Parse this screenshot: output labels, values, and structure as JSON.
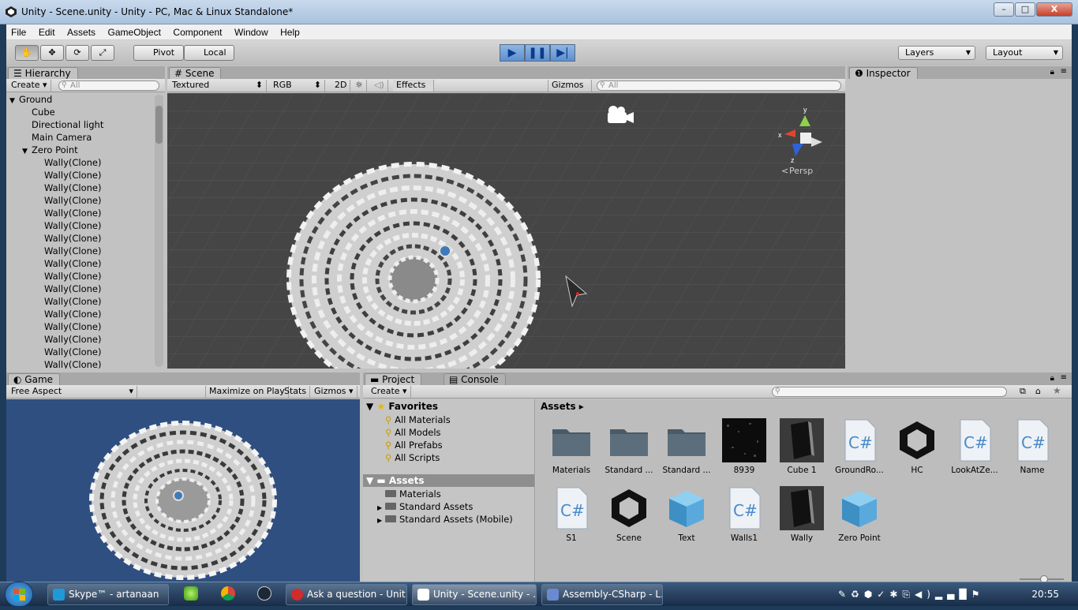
{
  "window": {
    "title": "Unity - Scene.unity - Unity - PC, Mac & Linux Standalone*",
    "min": "–",
    "max": "□",
    "close": "X"
  },
  "menu": [
    "File",
    "Edit",
    "Assets",
    "GameObject",
    "Component",
    "Window",
    "Help"
  ],
  "toolbar": {
    "pivot": "Pivot",
    "local": "Local",
    "layers": "Layers",
    "layout": "Layout"
  },
  "hierarchy": {
    "tab": "Hierarchy",
    "create": "Create",
    "search_placeholder": "All",
    "items": [
      {
        "label": "Ground",
        "indent": 0,
        "arrow": "▼"
      },
      {
        "label": "Cube",
        "indent": 1,
        "arrow": ""
      },
      {
        "label": "Directional light",
        "indent": 1,
        "arrow": ""
      },
      {
        "label": "Main Camera",
        "indent": 1,
        "arrow": ""
      },
      {
        "label": "Zero Point",
        "indent": 1,
        "arrow": "▼"
      },
      {
        "label": "Wally(Clone)",
        "indent": 2,
        "arrow": ""
      },
      {
        "label": "Wally(Clone)",
        "indent": 2,
        "arrow": ""
      },
      {
        "label": "Wally(Clone)",
        "indent": 2,
        "arrow": ""
      },
      {
        "label": "Wally(Clone)",
        "indent": 2,
        "arrow": ""
      },
      {
        "label": "Wally(Clone)",
        "indent": 2,
        "arrow": ""
      },
      {
        "label": "Wally(Clone)",
        "indent": 2,
        "arrow": ""
      },
      {
        "label": "Wally(Clone)",
        "indent": 2,
        "arrow": ""
      },
      {
        "label": "Wally(Clone)",
        "indent": 2,
        "arrow": ""
      },
      {
        "label": "Wally(Clone)",
        "indent": 2,
        "arrow": ""
      },
      {
        "label": "Wally(Clone)",
        "indent": 2,
        "arrow": ""
      },
      {
        "label": "Wally(Clone)",
        "indent": 2,
        "arrow": ""
      },
      {
        "label": "Wally(Clone)",
        "indent": 2,
        "arrow": ""
      },
      {
        "label": "Wally(Clone)",
        "indent": 2,
        "arrow": ""
      },
      {
        "label": "Wally(Clone)",
        "indent": 2,
        "arrow": ""
      },
      {
        "label": "Wally(Clone)",
        "indent": 2,
        "arrow": ""
      },
      {
        "label": "Wally(Clone)",
        "indent": 2,
        "arrow": ""
      },
      {
        "label": "Wally(Clone)",
        "indent": 2,
        "arrow": ""
      }
    ]
  },
  "scene": {
    "tab": "Scene",
    "shading": "Textured",
    "render": "RGB",
    "mode2d": "2D",
    "effects": "Effects",
    "gizmos": "Gizmos",
    "search_placeholder": "All",
    "persp": "Persp",
    "axis_x": "x",
    "axis_y": "y",
    "axis_z": "z"
  },
  "inspector": {
    "tab": "Inspector"
  },
  "game": {
    "tab": "Game",
    "aspect": "Free Aspect",
    "maximize": "Maximize on Play",
    "stats": "Stats",
    "gizmos": "Gizmos"
  },
  "project": {
    "tab": "Project",
    "console_tab": "Console",
    "create": "Create",
    "breadcrumb": "Assets",
    "favorites_title": "Favorites",
    "favorites": [
      "All Materials",
      "All Models",
      "All Prefabs",
      "All Scripts"
    ],
    "assets_title": "Assets",
    "folders": [
      {
        "label": "Materials",
        "arrow": ""
      },
      {
        "label": "Standard Assets",
        "arrow": "▶"
      },
      {
        "label": "Standard Assets (Mobile)",
        "arrow": "▶"
      }
    ],
    "assets": [
      {
        "label": "Materials",
        "kind": "folder"
      },
      {
        "label": "Standard ...",
        "kind": "folder"
      },
      {
        "label": "Standard ...",
        "kind": "folder"
      },
      {
        "label": "8939",
        "kind": "texture"
      },
      {
        "label": "Cube 1",
        "kind": "prefab"
      },
      {
        "label": "GroundRo...",
        "kind": "script"
      },
      {
        "label": "HC",
        "kind": "unity"
      },
      {
        "label": "LookAtZe...",
        "kind": "script"
      },
      {
        "label": "Name",
        "kind": "script"
      },
      {
        "label": "S1",
        "kind": "script"
      },
      {
        "label": "Scene",
        "kind": "unity"
      },
      {
        "label": "Text",
        "kind": "cube"
      },
      {
        "label": "Walls1",
        "kind": "script"
      },
      {
        "label": "Wally",
        "kind": "prefab"
      },
      {
        "label": "Zero Point",
        "kind": "cube"
      }
    ]
  },
  "taskbar": {
    "items": [
      {
        "label": "Skype™ - artanaan",
        "color": "#1f9ad8",
        "icon": "skype-icon"
      },
      {
        "label": "Ask a question - Unit...",
        "color": "#d12b2b",
        "icon": "opera-icon"
      },
      {
        "label": "Unity - Scene.unity - ...",
        "color": "#ffffff",
        "icon": "unity-icon"
      },
      {
        "label": "Assembly-CSharp - L...",
        "color": "#6a8ad0",
        "icon": "monodevelop-icon"
      }
    ],
    "clock": "20:55"
  }
}
